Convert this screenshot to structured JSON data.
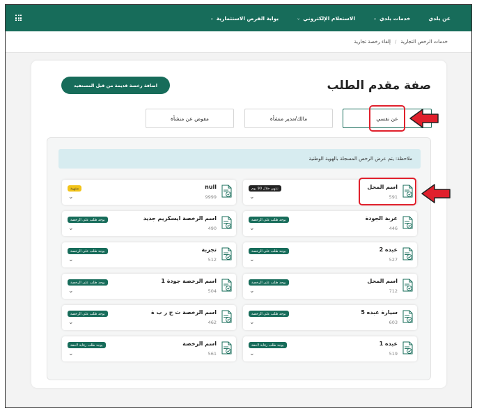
{
  "nav": {
    "items": [
      {
        "label": "عن بلدي",
        "dropdown": false
      },
      {
        "label": "خدمات بلدي",
        "dropdown": true
      },
      {
        "label": "الاستعلام الإلكتروني",
        "dropdown": true
      },
      {
        "label": "بوابة الفرص الاستثمارية",
        "dropdown": true
      }
    ]
  },
  "breadcrumb": {
    "parent": "خدمات الرخص التجارية",
    "separator": "/",
    "current": "إلغاء رخصة تجارية"
  },
  "page": {
    "title": "صفة مقدم الطلب",
    "add_button": "اضافة رخصة قديمة من قبل المستفيد",
    "tabs": [
      {
        "label": "عن نفسي",
        "active": true
      },
      {
        "label": "مالك/مدير منشأة",
        "active": false
      },
      {
        "label": "مفوض عن منشأة",
        "active": false
      }
    ],
    "notice": "ملاحظة: يتم عرض الرخص المسجلة بالهوية الوطنية"
  },
  "licenses": [
    {
      "name": "اسم المحل",
      "number": "591",
      "badge": "تنتهي خلال 90 يوم",
      "badge_style": "dark"
    },
    {
      "name": "null",
      "number": "9999",
      "badge": "منتهية",
      "badge_style": "yellow"
    },
    {
      "name": "عربة الجودة",
      "number": "446",
      "badge": "يوجد طلب على الرخصة",
      "badge_style": "green"
    },
    {
      "name": "اسم الرخصة ايسكريم جديد",
      "number": "490",
      "badge": "يوجد طلب على الرخصة",
      "badge_style": "green"
    },
    {
      "name": "عبده 2",
      "number": "527",
      "badge": "يوجد طلب على الرخصة",
      "badge_style": "green"
    },
    {
      "name": "تجربة",
      "number": "512",
      "badge": "يوجد طلب على الرخصة",
      "badge_style": "green"
    },
    {
      "name": "اسم المحل",
      "number": "712",
      "badge": "يوجد طلب على الرخصة",
      "badge_style": "green"
    },
    {
      "name": "اسم الرخصة جودة 1",
      "number": "504",
      "badge": "يوجد طلب على الرخصة",
      "badge_style": "green"
    },
    {
      "name": "سيارة عبده 5",
      "number": "603",
      "badge": "يوجد طلب على الرخصة",
      "badge_style": "green"
    },
    {
      "name": "اسم الرخصة ت ج ر ب ة",
      "number": "462",
      "badge": "يوجد طلب على الرخصة",
      "badge_style": "green"
    },
    {
      "name": "عبده 1",
      "number": "519",
      "badge": "يوجد طلب رقابة لاحقة",
      "badge_style": "green"
    },
    {
      "name": "اسم الرخصة",
      "number": "561",
      "badge": "يوجد طلب رقابة لاحقة",
      "badge_style": "green"
    }
  ],
  "icons": {
    "document": "document-check-icon",
    "expand": "chevron-down-icon",
    "menu": "grid-menu-icon",
    "annotation": "red-arrow-icon"
  },
  "colors": {
    "brand": "#176c5a",
    "highlight": "#e0202c",
    "notice_bg": "#d7ecf0",
    "warning": "#f2c318"
  }
}
